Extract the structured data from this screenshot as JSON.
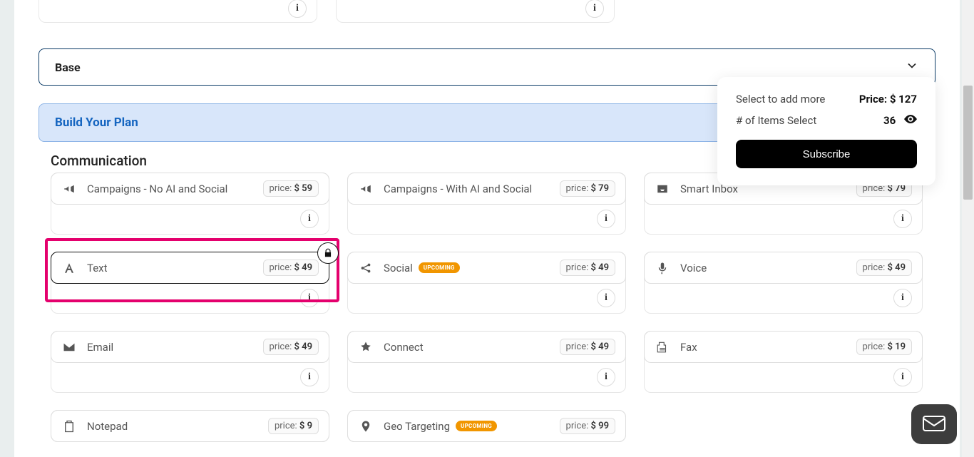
{
  "accordion": {
    "base_label": "Base"
  },
  "plan_header": {
    "label": "Build Your Plan"
  },
  "section": {
    "title": "Communication"
  },
  "price_prefix": "price: ",
  "currency": "$ ",
  "upcoming_label": "UPCOMING",
  "cards": {
    "c0": {
      "name": "Campaigns - No AI and Social",
      "price": "59"
    },
    "c1": {
      "name": "Campaigns - With AI and Social",
      "price": "79"
    },
    "c2": {
      "name": "Smart Inbox",
      "price": "79"
    },
    "c3": {
      "name": "Text",
      "price": "49"
    },
    "c4": {
      "name": "Social",
      "price": "49"
    },
    "c5": {
      "name": "Voice",
      "price": "49"
    },
    "c6": {
      "name": "Email",
      "price": "49"
    },
    "c7": {
      "name": "Connect",
      "price": "49"
    },
    "c8": {
      "name": "Fax",
      "price": "19"
    },
    "c9": {
      "name": "Notepad",
      "price": "9"
    },
    "c10": {
      "name": "Geo Targeting",
      "price": "99"
    }
  },
  "summary": {
    "select_more": "Select to add more",
    "price_label": "Price: ",
    "price_value": "$ 127",
    "items_label": "# of Items Select",
    "items_count": "36",
    "subscribe": "Subscribe"
  },
  "info_glyph": "i"
}
